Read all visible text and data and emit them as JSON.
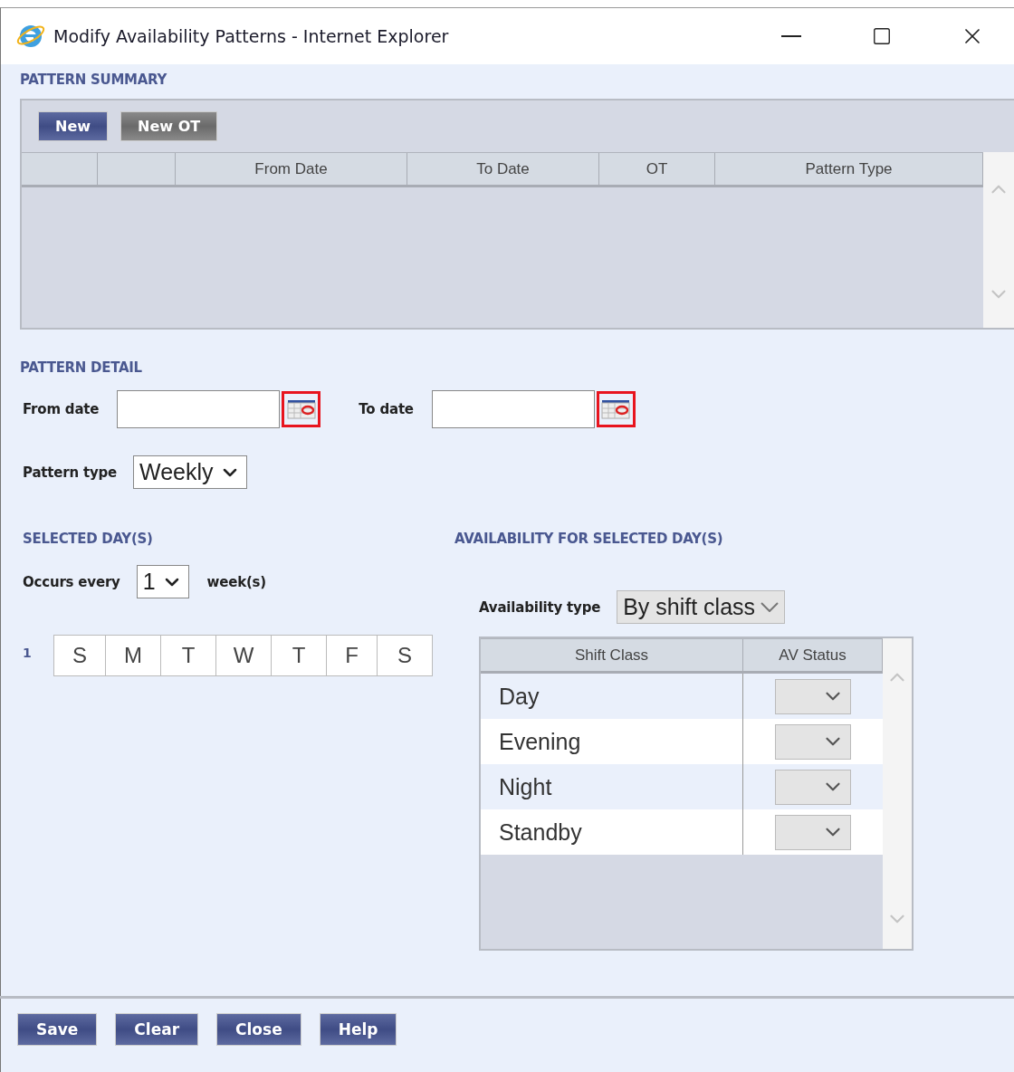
{
  "window": {
    "title": "Modify Availability Patterns - Internet Explorer"
  },
  "pattern_summary": {
    "heading": "PATTERN SUMMARY",
    "buttons": [
      {
        "label": "New",
        "disabled": false
      },
      {
        "label": "New OT",
        "disabled": true
      }
    ],
    "columns": [
      "From Date",
      "To Date",
      "OT",
      "Pattern Type"
    ]
  },
  "pattern_detail": {
    "heading": "PATTERN DETAIL",
    "from_date": {
      "label": "From date"
    },
    "to_date": {
      "label": "To date"
    },
    "pattern_type": {
      "label": "Pattern type",
      "value": "Weekly"
    }
  },
  "selected_days": {
    "heading": "SELECTED DAY(S)",
    "occurs_every": {
      "label": "Occurs every",
      "value": "1",
      "unit": "week(s)"
    },
    "weeks": [
      {
        "number": "1",
        "days": [
          "S",
          "M",
          "T",
          "W",
          "T",
          "F",
          "S"
        ]
      }
    ]
  },
  "availability": {
    "heading": "AVAILABILITY FOR SELECTED DAY(S)",
    "type": {
      "label": "Availability type",
      "value": "By shift class"
    },
    "columns": [
      "Shift Class",
      "AV Status"
    ],
    "rows": [
      {
        "shift_class": "Day"
      },
      {
        "shift_class": "Evening"
      },
      {
        "shift_class": "Night"
      },
      {
        "shift_class": "Standby"
      }
    ]
  },
  "footer_buttons": [
    "Save",
    "Clear",
    "Close",
    "Help"
  ]
}
